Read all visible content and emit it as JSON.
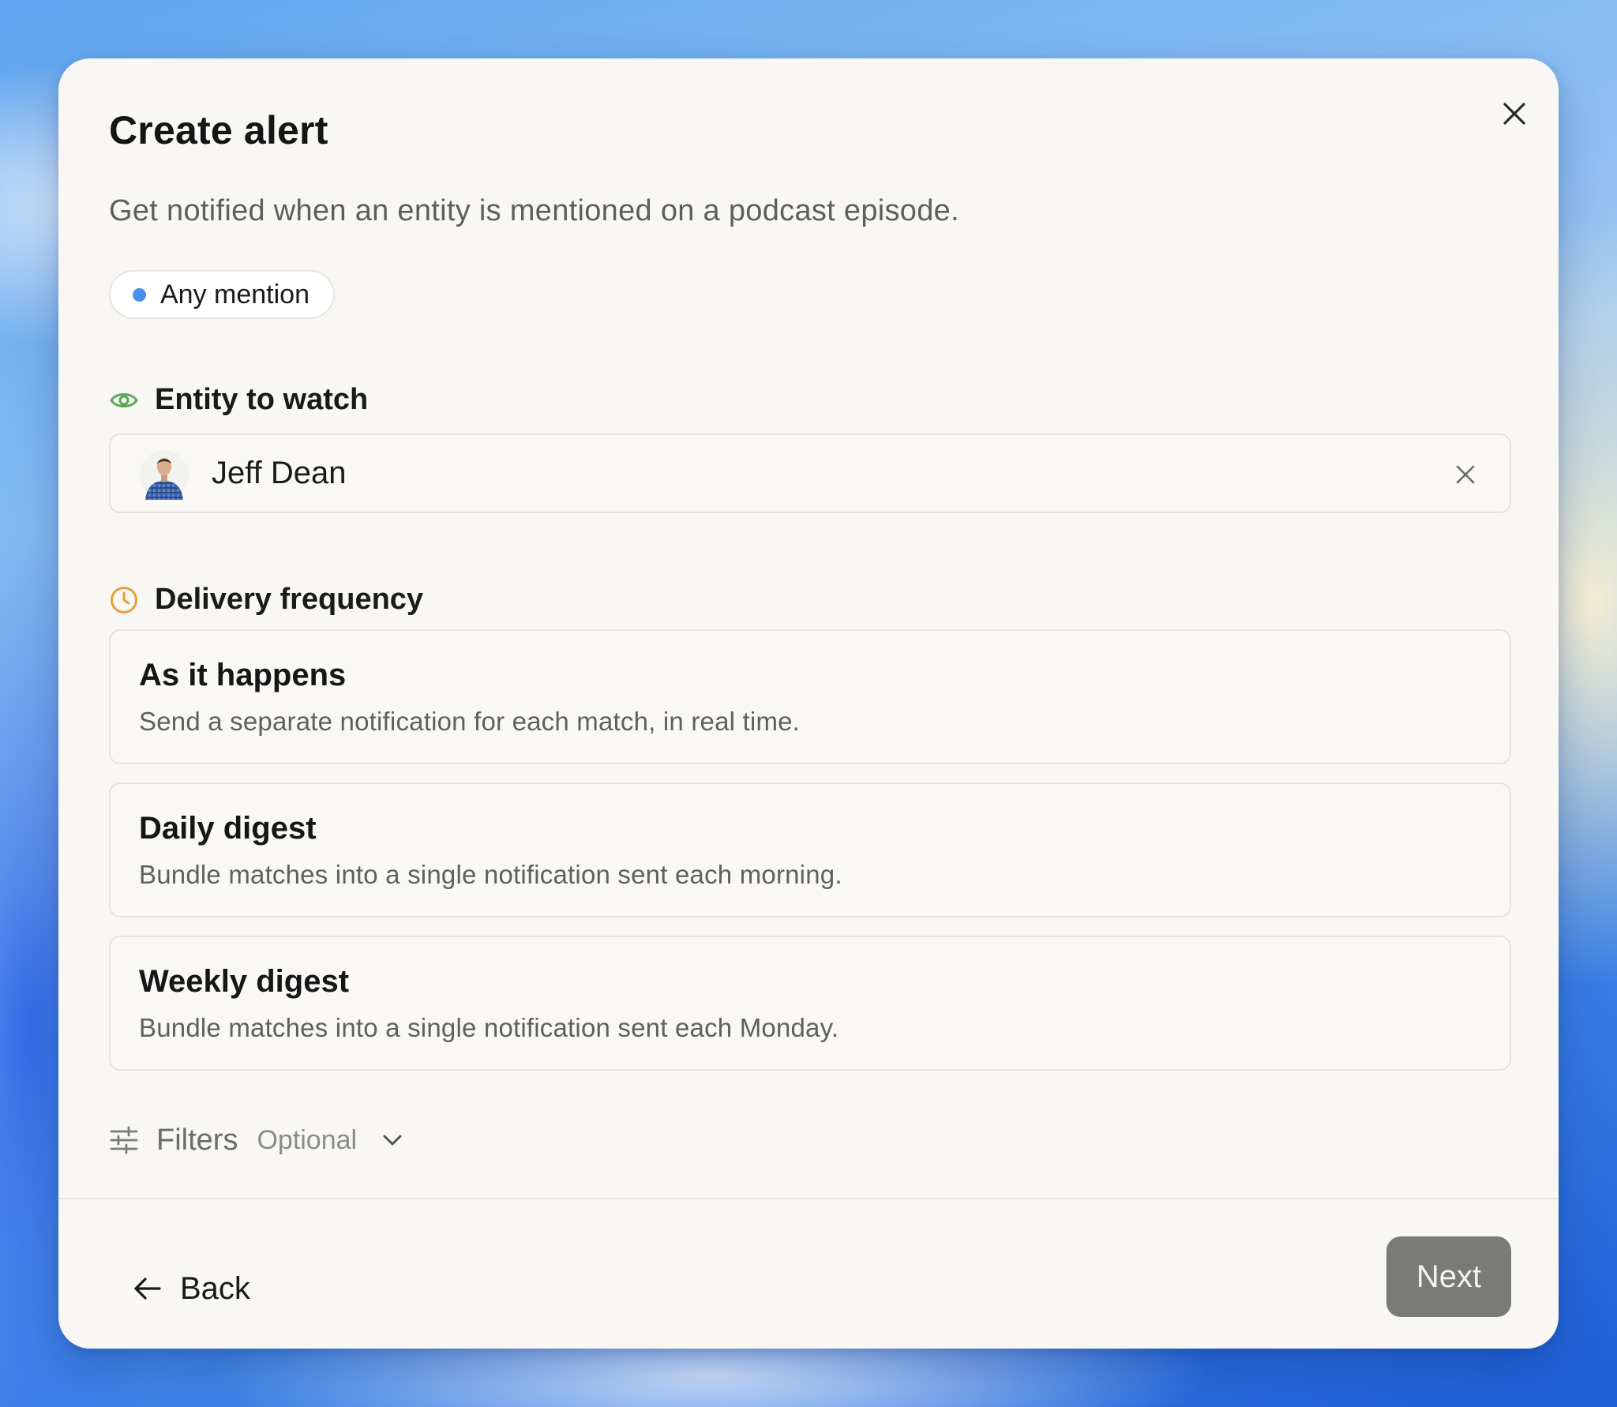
{
  "dialog": {
    "title": "Create alert",
    "subtitle": "Get notified when an entity is mentioned on a podcast episode.",
    "close_icon": "close-icon"
  },
  "mode": {
    "label": "Any mention",
    "dot_color": "#4a8ef0"
  },
  "entity_section": {
    "label": "Entity to watch",
    "icon": "eye-icon",
    "icon_color": "#5aa85a"
  },
  "entity_field": {
    "value": "Jeff Dean",
    "avatar_icon": "avatar",
    "clear_icon": "clear-icon"
  },
  "frequency_section": {
    "label": "Delivery frequency",
    "icon": "clock-icon",
    "icon_color": "#e3a23a"
  },
  "frequency_options": [
    {
      "title": "As it happens",
      "description": "Send a separate notification for each match, in real time."
    },
    {
      "title": "Daily digest",
      "description": "Bundle matches into a single notification sent each morning."
    },
    {
      "title": "Weekly digest",
      "description": "Bundle matches into a single notification sent each Monday."
    }
  ],
  "filters": {
    "label": "Filters",
    "optional_label": "Optional",
    "icon": "sliders-icon",
    "chevron_icon": "chevron-down-icon"
  },
  "footer": {
    "back_label": "Back",
    "back_icon": "arrow-left-icon",
    "next_label": "Next",
    "next_color": "#7a7a78"
  }
}
